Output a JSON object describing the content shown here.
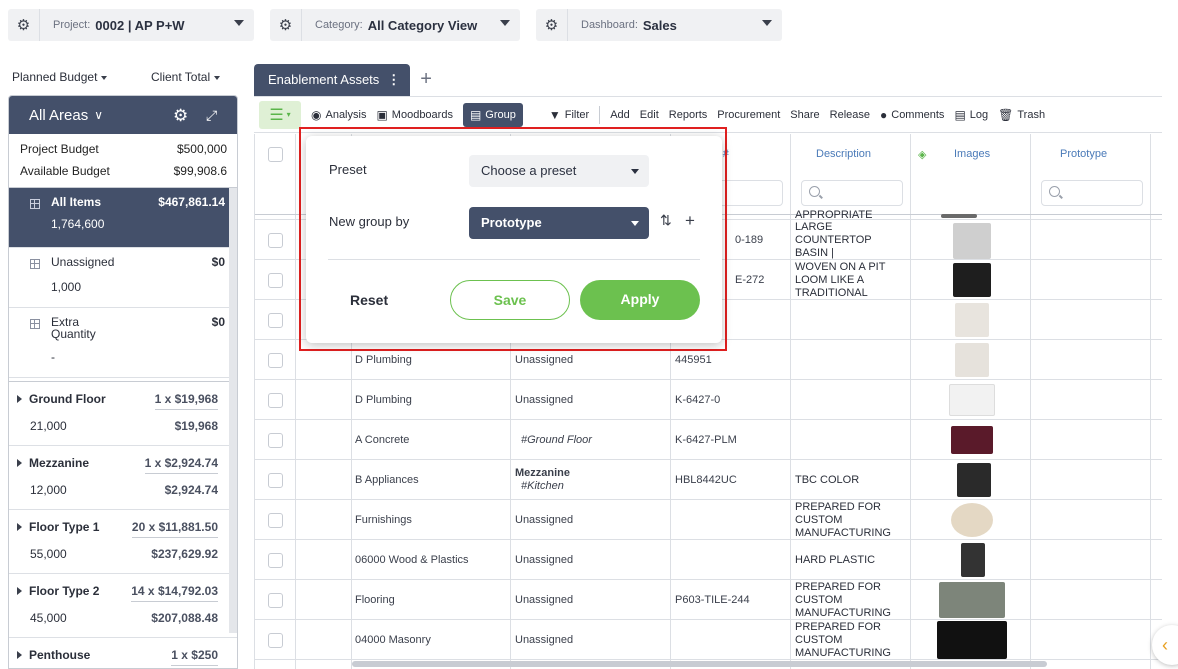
{
  "top_selectors": {
    "project": {
      "label": "Project:",
      "value": "0002 | AP P+W"
    },
    "category": {
      "label": "Category:",
      "value": "All Category View"
    },
    "dashboard": {
      "label": "Dashboard:",
      "value": "Sales"
    }
  },
  "budget_selectors": {
    "left": "Planned Budget",
    "right": "Client Total"
  },
  "sidebar": {
    "header": "All Areas",
    "project_budget_label": "Project Budget",
    "project_budget_value": "$500,000",
    "available_budget_label": "Available Budget",
    "available_budget_value": "$99,908.6",
    "items": [
      {
        "name": "All Items",
        "amount": "$467,861.14",
        "qty": "1,764,600"
      },
      {
        "name": "Unassigned",
        "amount": "$0",
        "qty": "1,000"
      },
      {
        "name": "Extra Quantity",
        "amount": "$0",
        "qty": "-"
      }
    ],
    "floors": [
      {
        "name": "Ground Floor",
        "qty": "1 x $19,968",
        "area": "21,000",
        "total": "$19,968"
      },
      {
        "name": "Mezzanine",
        "qty": "1 x $2,924.74",
        "area": "12,000",
        "total": "$2,924.74"
      },
      {
        "name": "Floor Type 1",
        "qty": "20 x $11,881.50",
        "area": "55,000",
        "total": "$237,629.92"
      },
      {
        "name": "Floor Type 2",
        "qty": "14 x $14,792.03",
        "area": "45,000",
        "total": "$207,088.48"
      },
      {
        "name": "Penthouse",
        "qty": "1 x $250",
        "area": "",
        "total": ""
      }
    ]
  },
  "tab": {
    "label": "Enablement Assets",
    "add": "+"
  },
  "toolbar": {
    "analysis": "Analysis",
    "moodboards": "Moodboards",
    "group": "Group",
    "filter": "Filter",
    "add": "Add",
    "edit": "Edit",
    "reports": "Reports",
    "procurement": "Procurement",
    "share": "Share",
    "release": "Release",
    "comments": "Comments",
    "log": "Log",
    "trash": "Trash"
  },
  "columns": {
    "model": "del #",
    "description": "Description",
    "images": "Images",
    "prototype": "Prototype"
  },
  "rows": [
    {
      "category": "",
      "area": "",
      "area_tag": "",
      "model": "",
      "desc": "APPROPRIATE",
      "thumb": "#6a6a6a"
    },
    {
      "category": "",
      "area": "",
      "area_tag": "",
      "model": "0-189",
      "desc": "LARGE COUNTERTOP BASIN |",
      "thumb": "#cfcfcf"
    },
    {
      "category": "",
      "area": "",
      "area_tag": "",
      "model": "E-272",
      "desc": "WOVEN ON A PIT LOOM LIKE A TRADITIONAL",
      "thumb": "#1e1e1e"
    },
    {
      "category": "",
      "area": "",
      "area_tag": "",
      "model": "",
      "desc": "",
      "thumb": "#e8e4de"
    },
    {
      "category": "D Plumbing",
      "area": "Unassigned",
      "area_tag": "",
      "model": "445951",
      "desc": "",
      "thumb": "#e6e2dc"
    },
    {
      "category": "D Plumbing",
      "area": "Unassigned",
      "area_tag": "",
      "model": "K-6427-0",
      "desc": "",
      "thumb": "#f2f2f2"
    },
    {
      "category": "A Concrete",
      "area": "",
      "area_tag": "#Ground Floor",
      "model": "K-6427-PLM",
      "desc": "",
      "thumb": "#5a1a2a"
    },
    {
      "category": "B Appliances",
      "area": "Mezzanine",
      "area_tag": "#Kitchen",
      "model": "HBL8442UC",
      "desc": "TBC COLOR",
      "thumb": "#2a2a2a"
    },
    {
      "category": "Furnishings",
      "area": "Unassigned",
      "area_tag": "",
      "model": "",
      "desc": "PREPARED FOR CUSTOM MANUFACTURING",
      "thumb": "#e4d8c4"
    },
    {
      "category": "06000 Wood & Plastics",
      "area": "Unassigned",
      "area_tag": "",
      "model": "",
      "desc": "HARD PLASTIC",
      "thumb": "#333333"
    },
    {
      "category": "Flooring",
      "area": "Unassigned",
      "area_tag": "",
      "model": "P603-TILE-244",
      "desc": "PREPARED FOR CUSTOM MANUFACTURING",
      "thumb": "#7d857a"
    },
    {
      "category": "04000 Masonry",
      "area": "Unassigned",
      "area_tag": "",
      "model": "",
      "desc": "PREPARED FOR CUSTOM MANUFACTURING",
      "thumb": "#111111"
    }
  ],
  "popup": {
    "preset_label": "Preset",
    "preset_value": "Choose a preset",
    "group_label": "New group by",
    "group_value": "Prototype",
    "reset": "Reset",
    "save": "Save",
    "apply": "Apply"
  },
  "colors": {
    "navy": "#44506a",
    "green": "#6cc14f",
    "highlight": "#e02020"
  }
}
